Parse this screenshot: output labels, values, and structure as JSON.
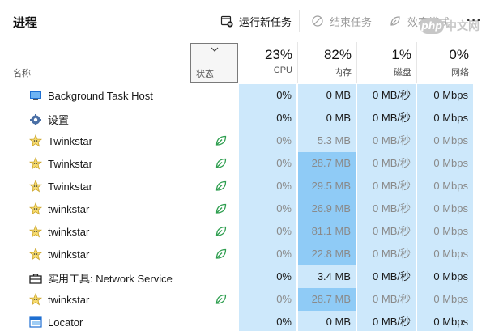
{
  "toolbar": {
    "title": "进程",
    "run_task": "运行新任务",
    "end_task": "结束任务",
    "efficiency": "效率模式",
    "more": "···",
    "watermark_logo": "php",
    "watermark_text": "中文网"
  },
  "header": {
    "name": "名称",
    "status": "状态",
    "cpu_pct": "23%",
    "cpu": "CPU",
    "mem_pct": "82%",
    "mem": "内存",
    "disk_pct": "1%",
    "disk": "磁盘",
    "net_pct": "0%",
    "net": "网络"
  },
  "rows": [
    {
      "name": "Background Task Host",
      "icon": "app-window-icon",
      "eco": false,
      "cpu": "0%",
      "mem": "0 MB",
      "disk": "0 MB/秒",
      "net": "0 Mbps",
      "dim": false,
      "mem_hi": false
    },
    {
      "name": "设置",
      "icon": "gear-icon",
      "eco": false,
      "cpu": "0%",
      "mem": "0 MB",
      "disk": "0 MB/秒",
      "net": "0 Mbps",
      "dim": false,
      "mem_hi": false
    },
    {
      "name": "Twinkstar",
      "icon": "star-icon",
      "eco": true,
      "cpu": "0%",
      "mem": "5.3 MB",
      "disk": "0 MB/秒",
      "net": "0 Mbps",
      "dim": true,
      "mem_hi": false
    },
    {
      "name": "Twinkstar",
      "icon": "star-icon",
      "eco": true,
      "cpu": "0%",
      "mem": "28.7 MB",
      "disk": "0 MB/秒",
      "net": "0 Mbps",
      "dim": true,
      "mem_hi": true
    },
    {
      "name": "Twinkstar",
      "icon": "star-icon",
      "eco": true,
      "cpu": "0%",
      "mem": "29.5 MB",
      "disk": "0 MB/秒",
      "net": "0 Mbps",
      "dim": true,
      "mem_hi": true
    },
    {
      "name": "twinkstar",
      "icon": "star-icon",
      "eco": true,
      "cpu": "0%",
      "mem": "26.9 MB",
      "disk": "0 MB/秒",
      "net": "0 Mbps",
      "dim": true,
      "mem_hi": true
    },
    {
      "name": "twinkstar",
      "icon": "star-icon",
      "eco": true,
      "cpu": "0%",
      "mem": "81.1 MB",
      "disk": "0 MB/秒",
      "net": "0 Mbps",
      "dim": true,
      "mem_hi": true
    },
    {
      "name": "twinkstar",
      "icon": "star-icon",
      "eco": true,
      "cpu": "0%",
      "mem": "22.8 MB",
      "disk": "0 MB/秒",
      "net": "0 Mbps",
      "dim": true,
      "mem_hi": true
    },
    {
      "name": "实用工具: Network Service",
      "icon": "toolbox-icon",
      "eco": false,
      "cpu": "0%",
      "mem": "3.4 MB",
      "disk": "0 MB/秒",
      "net": "0 Mbps",
      "dim": false,
      "mem_hi": false
    },
    {
      "name": "twinkstar",
      "icon": "star-icon",
      "eco": true,
      "cpu": "0%",
      "mem": "28.7 MB",
      "disk": "0 MB/秒",
      "net": "0 Mbps",
      "dim": true,
      "mem_hi": true
    },
    {
      "name": "Locator",
      "icon": "window-blue-icon",
      "eco": false,
      "cpu": "0%",
      "mem": "0 MB",
      "disk": "0 MB/秒",
      "net": "0 Mbps",
      "dim": false,
      "mem_hi": false
    }
  ],
  "colors": {
    "heat_low": "#cde8fb",
    "heat_mem": "#8fcbf6",
    "eco_green": "#2e9e4f"
  }
}
